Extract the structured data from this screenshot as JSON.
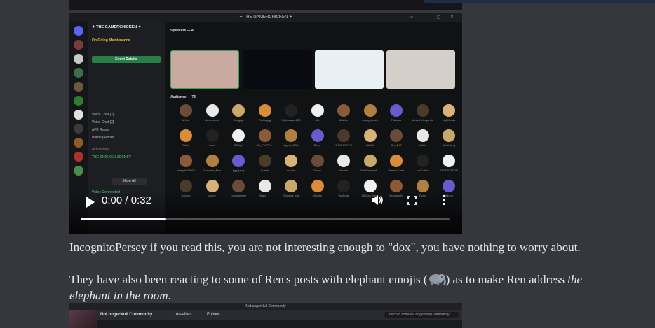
{
  "video1": {
    "window_title": "✦ THE GAMERCHICKEN ✦",
    "server_name": "✦ THE GAMERCHICKEN ✦",
    "ongoing_label": "On Going Maintenance",
    "event_button": "Event Details",
    "channels": [
      "Voice Chat [2]",
      "Voice Chat [3]",
      "AFK Room",
      "Waiting Room"
    ],
    "active_now_label": "Active Now",
    "active_channel": "THE CHICKEN JOCKEY",
    "show_all": "Show All",
    "voice_connected": "Voice Connected",
    "speakers_label": "Speakers — 4",
    "audience_label": "Audience — 73",
    "audience_names": [
      [
        "Arthur",
        "drmrevans",
        "Hodgaja",
        "TheDaggy",
        "Nightstayer123",
        "elle",
        "Matthe",
        "orangebeats",
        "Fabolus",
        "Moved Morganite",
        "LightCoolz"
      ],
      [
        "Raiber",
        "Ivano",
        "GGrlgrl",
        "DA_PUFFY...",
        "Agent_CAS",
        "Dicky",
        "THEPURPLE",
        "ttttBall",
        "Bro_DIR",
        "traffic",
        "DarthKing"
      ],
      [
        "penguin34605",
        "Convolte_Plus",
        "jiggajang",
        "Lostie",
        "xcsolar",
        "Snom",
        "donnie",
        "DartCheeseF...",
        "WarriorCode",
        "JustCotton",
        "ERADICATOR"
      ],
      [
        "Darvon",
        "scoey",
        "Dogorimmer",
        "Black_1",
        "Shadow_cat",
        "Minisbe",
        "YouDude",
        "All Dow Bunk",
        "XxspaceXx",
        "Dyno",
        "ahloon"
      ]
    ],
    "time_display": "0:00 / 0:32",
    "progress": 0.23
  },
  "paragraphs": {
    "p1": "IncognitoPersey if you read this, you are not interesting enough to \"dox\", you have nothing to worry about.",
    "p2_start": "They have also been reacting to some of Ren's posts with elephant emojis (",
    "p2_emoji_name": "elephant",
    "p2_mid": ") as to make Ren address ",
    "p2_italic_1": "the",
    "p2_italic_2": "elephant in the room",
    "p2_end": "."
  },
  "video2": {
    "window_title": "NoLongerNull Community",
    "server_name": "NoLongerNull Community",
    "channel": "ren-allies",
    "tab": "Follow",
    "url": "discord.com/NoLongerNull Community"
  },
  "colors": {
    "page_bg": "#35373d",
    "discord_green": "#248046",
    "voice_green": "#3ba55d"
  }
}
